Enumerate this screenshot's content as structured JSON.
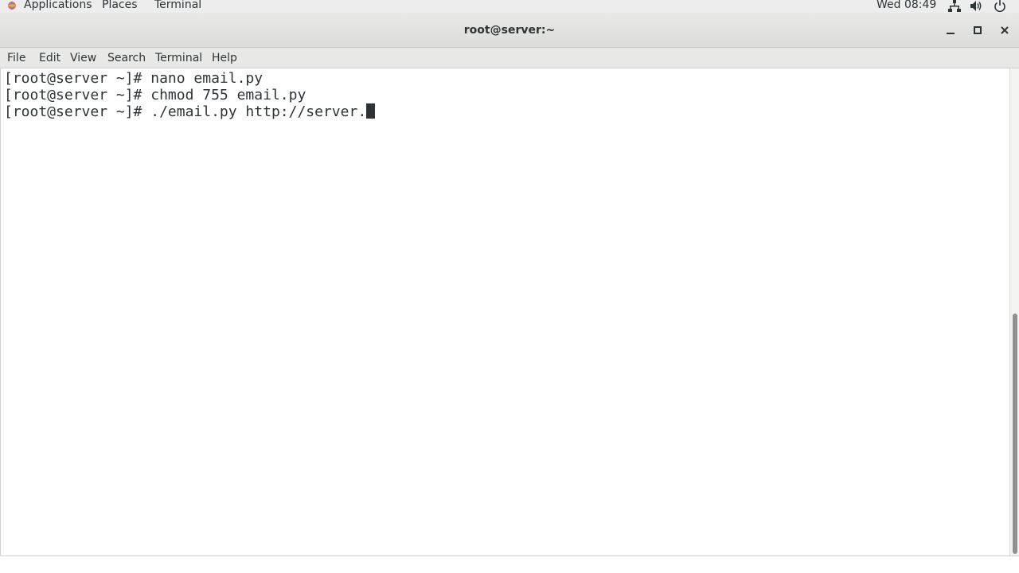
{
  "top_panel": {
    "menu": [
      "Applications",
      "Places",
      "Terminal"
    ],
    "clock": "Wed 08:49",
    "tray_icons": [
      "network-icon",
      "volume-icon",
      "power-icon"
    ]
  },
  "window": {
    "title": "root@server:~",
    "controls": [
      "minimize-icon",
      "maximize-icon",
      "close-icon"
    ]
  },
  "menubar": {
    "items": [
      "File",
      "Edit",
      "View",
      "Search",
      "Terminal",
      "Help"
    ]
  },
  "terminal": {
    "lines": [
      "[root@server ~]# nano email.py",
      "[root@server ~]# chmod 755 email.py",
      "[root@server ~]# ./email.py http://server."
    ],
    "colors": {
      "foreground": "#2e3436",
      "background": "#ffffff"
    }
  }
}
